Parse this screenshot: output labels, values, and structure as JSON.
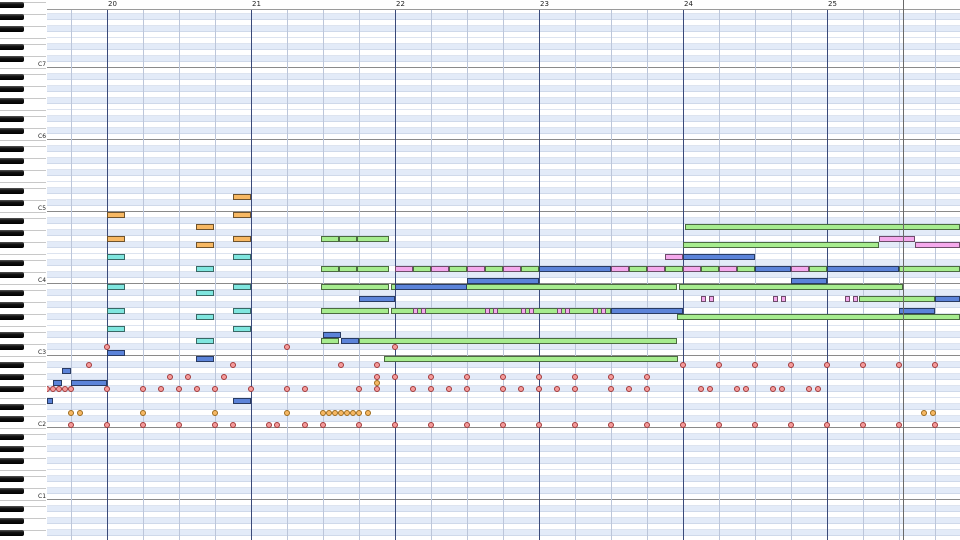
{
  "ruler": {
    "bars": [
      "20",
      "21",
      "22",
      "23",
      "24",
      "25"
    ]
  },
  "keyboard": {
    "octaves": [
      "C7",
      "C6",
      "C5",
      "C4",
      "C3",
      "C2",
      "C1"
    ]
  },
  "colors": {
    "green": "#a6ec8e",
    "blue": "#5b83d9",
    "orange": "#f7b863",
    "cyan": "#7fe6df",
    "pink": "#f4a9ec",
    "drum_red": "#f59a9a",
    "drum_orange": "#f7b863",
    "row_black": "#e3ebf8",
    "bar_line": "#3a4a7a"
  },
  "icons": {
    "drum_hit": "circle"
  }
}
